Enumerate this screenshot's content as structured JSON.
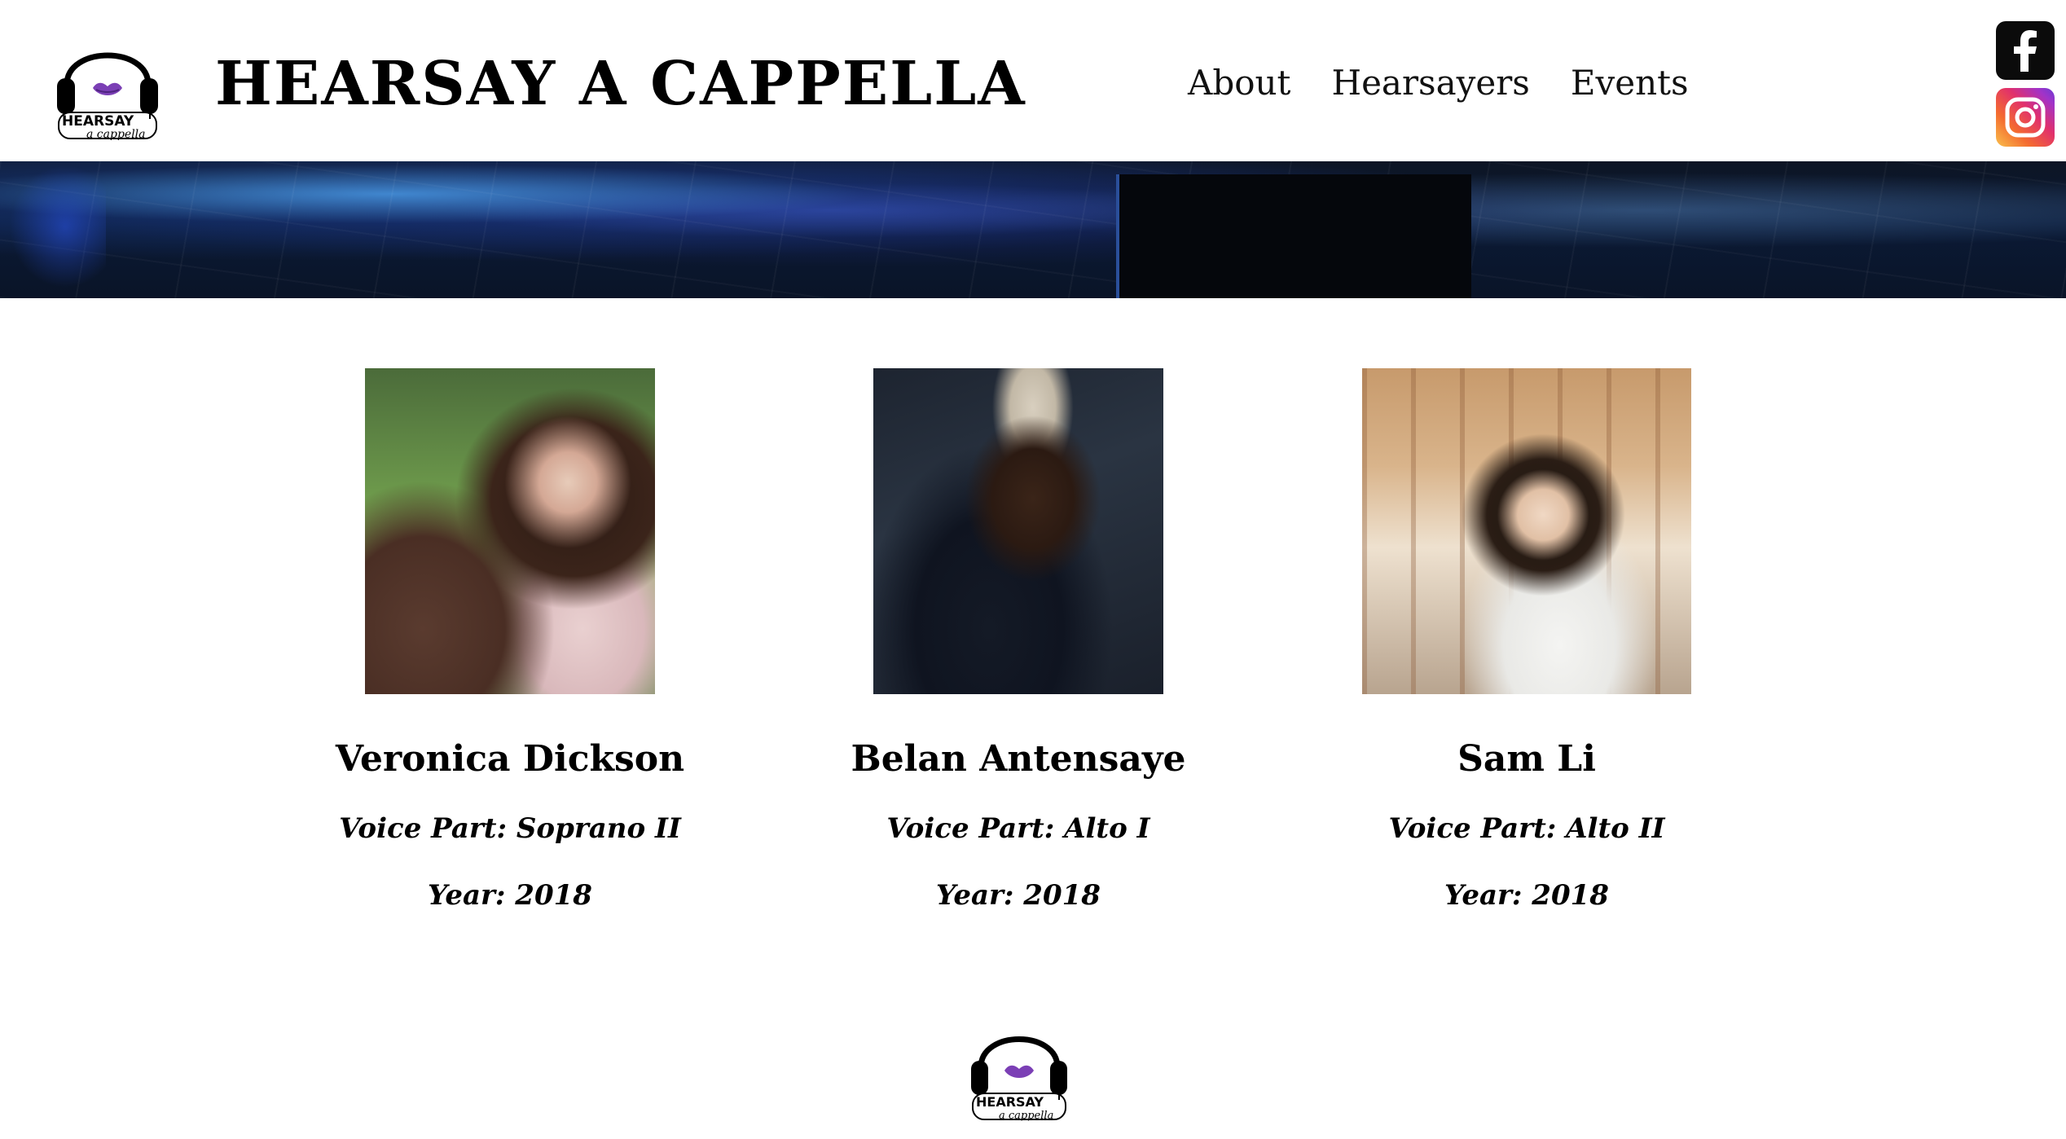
{
  "header": {
    "site_title": "HEARSAY A CAPPELLA",
    "logo_text_top": "HEARSAY",
    "logo_text_bottom": "a cappella",
    "nav": [
      {
        "label": "About"
      },
      {
        "label": "Hearsayers"
      },
      {
        "label": "Events"
      }
    ],
    "social": [
      {
        "name": "facebook-icon",
        "glyph": "f"
      },
      {
        "name": "instagram-icon"
      }
    ]
  },
  "members": [
    {
      "name": "Veronica Dickson",
      "voice_part": "Voice Part: Soprano II",
      "year": "Year: 2018"
    },
    {
      "name": "Belan Antensaye",
      "voice_part": "Voice Part: Alto I",
      "year": "Year: 2018"
    },
    {
      "name": "Sam Li",
      "voice_part": "Voice Part: Alto II",
      "year": "Year: 2018"
    }
  ],
  "footer": {
    "logo_text_top": "HEARSAY",
    "logo_text_bottom": "a cappella"
  },
  "colors": {
    "lips": "#7b3fb5",
    "text": "#000000",
    "background": "#ffffff"
  }
}
